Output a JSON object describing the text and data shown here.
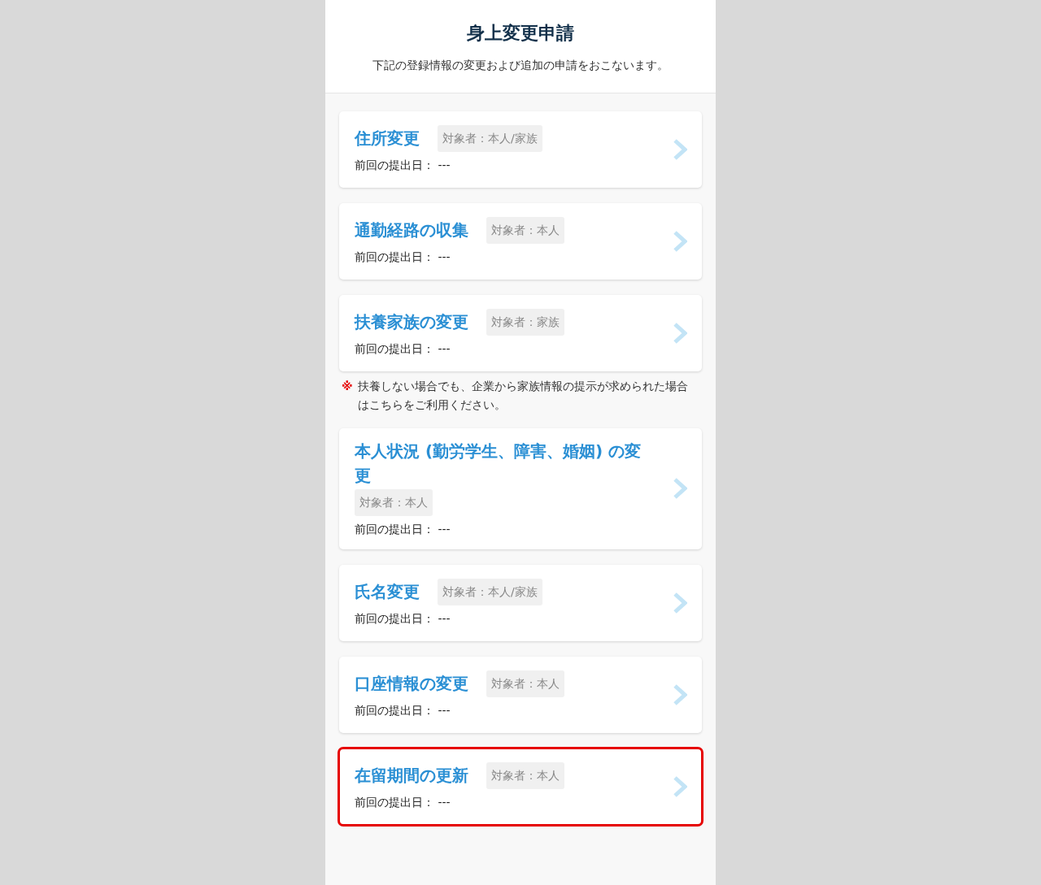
{
  "header": {
    "title": "身上変更申請",
    "subtitle": "下記の登録情報の変更および追加の申請をおこないます。"
  },
  "items": [
    {
      "kind": "card",
      "title": "住所変更",
      "tag": "対象者：本人/家族",
      "date_label": "前回の提出日：",
      "date_value": "---",
      "highlighted": false
    },
    {
      "kind": "card",
      "title": "通勤経路の収集",
      "tag": "対象者：本人",
      "date_label": "前回の提出日：",
      "date_value": "---",
      "highlighted": false
    },
    {
      "kind": "card",
      "title": "扶養家族の変更",
      "tag": "対象者：家族",
      "date_label": "前回の提出日：",
      "date_value": "---",
      "highlighted": false
    },
    {
      "kind": "note",
      "mark": "※",
      "text": "扶養しない場合でも、企業から家族情報の提示が求められた場合はこちらをご利用ください。"
    },
    {
      "kind": "card",
      "title": "本人状況 (勤労学生、障害、婚姻) の変更",
      "tag": "対象者：本人",
      "date_label": "前回の提出日：",
      "date_value": "---",
      "highlighted": false
    },
    {
      "kind": "card",
      "title": "氏名変更",
      "tag": "対象者：本人/家族",
      "date_label": "前回の提出日：",
      "date_value": "---",
      "highlighted": false
    },
    {
      "kind": "card",
      "title": "口座情報の変更",
      "tag": "対象者：本人",
      "date_label": "前回の提出日：",
      "date_value": "---",
      "highlighted": false
    },
    {
      "kind": "card",
      "title": "在留期間の更新",
      "tag": "対象者：本人",
      "date_label": "前回の提出日：",
      "date_value": "---",
      "highlighted": true
    }
  ]
}
